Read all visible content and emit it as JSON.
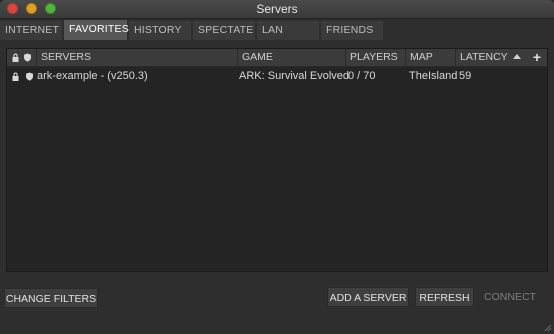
{
  "window": {
    "title": "Servers"
  },
  "tabs": [
    {
      "label": "INTERNET",
      "active": false
    },
    {
      "label": "FAVORITES",
      "active": true
    },
    {
      "label": "HISTORY",
      "active": false
    },
    {
      "label": "SPECTATE",
      "active": false
    },
    {
      "label": "LAN",
      "active": false
    },
    {
      "label": "FRIENDS",
      "active": false
    }
  ],
  "table": {
    "columns": {
      "servers": "SERVERS",
      "game": "GAME",
      "players": "PLAYERS",
      "map": "MAP",
      "latency": "LATENCY"
    },
    "add_column_label": "+",
    "rows": [
      {
        "server": "ark-example - (v250.3)",
        "game": "ARK: Survival Evolved",
        "players": "0 / 70",
        "map": "TheIsland",
        "latency": "59"
      }
    ]
  },
  "footer": {
    "change_filters": "CHANGE FILTERS",
    "add_server": "ADD A SERVER",
    "refresh": "REFRESH",
    "connect": "CONNECT"
  },
  "colors": {
    "close": "#e0443e",
    "minimize": "#dea123",
    "maximize": "#4fb637",
    "active_tab": "#575757"
  }
}
